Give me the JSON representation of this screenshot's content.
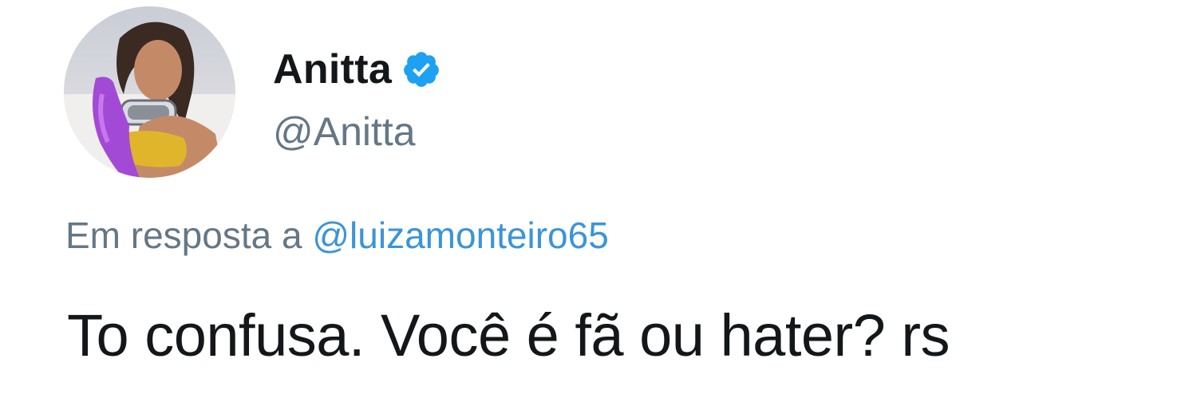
{
  "tweet": {
    "author": {
      "display_name": "Anitta",
      "handle": "@Anitta",
      "verified_icon": "verified-badge-icon",
      "avatar": "profile-photo"
    },
    "reply": {
      "prefix": "Em resposta a",
      "mention": "@luizamonteiro65"
    },
    "text": "To confusa. Você é fã ou hater? rs"
  },
  "colors": {
    "verified_badge": "#1da1f2",
    "mention_link": "#3b94d9",
    "secondary_text": "#657786",
    "primary_text": "#14171a"
  }
}
